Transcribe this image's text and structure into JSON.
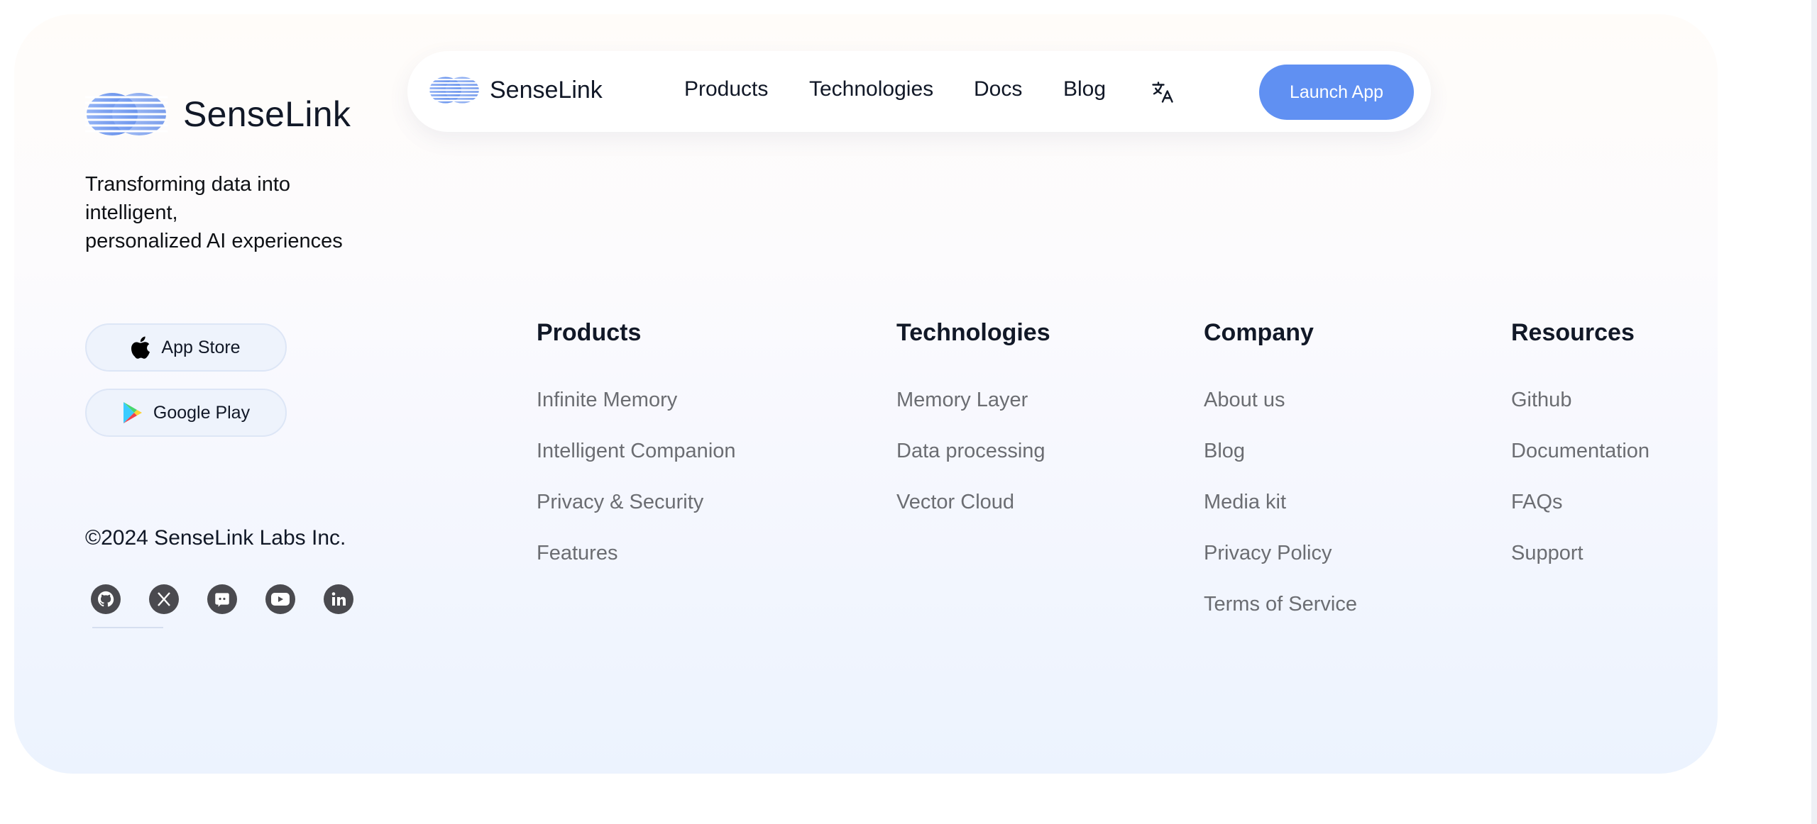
{
  "brand": {
    "name": "SenseLink",
    "tagline_lines": [
      "Transforming data into",
      "intelligent,",
      "personalized AI experiences"
    ]
  },
  "nav": {
    "brand_name": "SenseLink",
    "links": [
      "Products",
      "Technologies",
      "Docs",
      "Blog"
    ],
    "language_icon": "translate-icon",
    "cta_label": "Launch App"
  },
  "stores": {
    "app_store": "App Store",
    "google_play": "Google Play"
  },
  "copyright": "©2024 SenseLink Labs Inc.",
  "socials": [
    "github-icon",
    "x-icon",
    "discord-icon",
    "youtube-icon",
    "linkedin-icon"
  ],
  "columns": [
    {
      "title": "Products",
      "links": [
        "Infinite Memory",
        "Intelligent Companion",
        "Privacy & Security",
        "Features"
      ]
    },
    {
      "title": "Technologies",
      "links": [
        "Memory Layer",
        "Data processing",
        "Vector Cloud"
      ]
    },
    {
      "title": "Company",
      "links": [
        "About us",
        "Blog",
        "Media kit",
        "Privacy Policy",
        "Terms of Service"
      ]
    },
    {
      "title": "Resources",
      "links": [
        "Github",
        "Documentation",
        "FAQs",
        "Support"
      ]
    }
  ],
  "colors": {
    "accent": "#6090f2",
    "text": "#111827",
    "muted_link": "#6b6d72",
    "social_icon": "#4a4a4f"
  }
}
